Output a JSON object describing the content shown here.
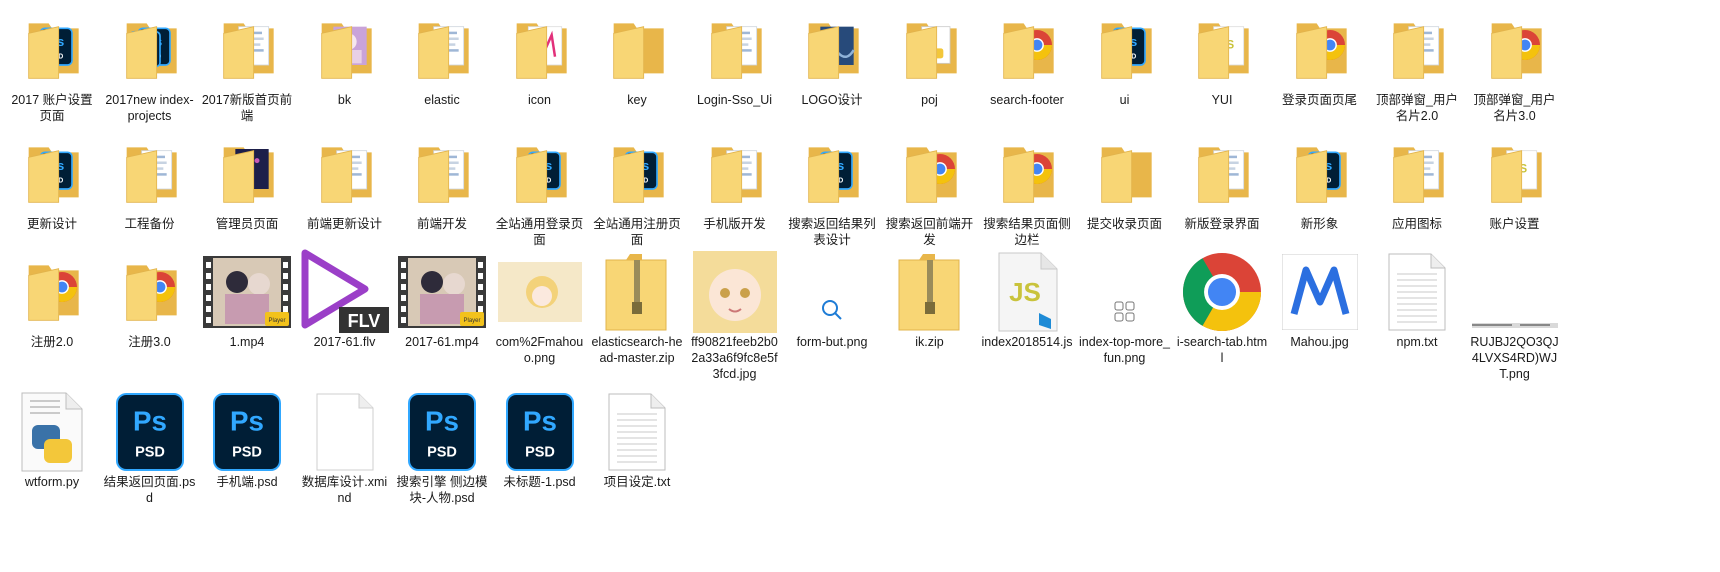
{
  "files": [
    {
      "label": "2017 账户设置页面",
      "icon": "folder",
      "content": "ps"
    },
    {
      "label": "2017new index-projects",
      "icon": "folder",
      "content": "ps2"
    },
    {
      "label": "2017新版首页前端",
      "icon": "folder",
      "content": "docs"
    },
    {
      "label": "bk",
      "icon": "folder",
      "content": "anime"
    },
    {
      "label": "elastic",
      "icon": "folder",
      "content": "docs"
    },
    {
      "label": "icon",
      "icon": "folder",
      "content": "mahou"
    },
    {
      "label": "key",
      "icon": "folder",
      "content": "plain"
    },
    {
      "label": "Login-Sso_Ui",
      "icon": "folder",
      "content": "docs"
    },
    {
      "label": "LOGO设计",
      "icon": "folder",
      "content": "starry"
    },
    {
      "label": "poj",
      "icon": "folder",
      "content": "python"
    },
    {
      "label": "search-footer",
      "icon": "folder",
      "content": "chrome"
    },
    {
      "label": "ui",
      "icon": "folder",
      "content": "ps"
    },
    {
      "label": "YUI",
      "icon": "folder",
      "content": "js"
    },
    {
      "label": "登录页面页尾",
      "icon": "folder",
      "content": "chrome"
    },
    {
      "label": "顶部弹窗_用户名片2.0",
      "icon": "folder",
      "content": "docs"
    },
    {
      "label": "顶部弹窗_用户名片3.0",
      "icon": "folder",
      "content": "chrome"
    },
    {
      "label": "更新设计",
      "icon": "folder",
      "content": "ps"
    },
    {
      "label": "工程备份",
      "icon": "folder",
      "content": "docs"
    },
    {
      "label": "管理员页面",
      "icon": "folder",
      "content": "dark"
    },
    {
      "label": "前端更新设计",
      "icon": "folder",
      "content": "docs"
    },
    {
      "label": "前端开发",
      "icon": "folder",
      "content": "docs"
    },
    {
      "label": "全站通用登录页面",
      "icon": "folder",
      "content": "ps"
    },
    {
      "label": "全站通用注册页面",
      "icon": "folder",
      "content": "ps"
    },
    {
      "label": "手机版开发",
      "icon": "folder",
      "content": "docs"
    },
    {
      "label": "搜索返回结果列表设计",
      "icon": "folder",
      "content": "ps"
    },
    {
      "label": "搜索返回前端开发",
      "icon": "folder",
      "content": "chrome"
    },
    {
      "label": "搜索结果页面侧边栏",
      "icon": "folder",
      "content": "chrome"
    },
    {
      "label": "提交收录页面",
      "icon": "folder",
      "content": "plain"
    },
    {
      "label": "新版登录界面",
      "icon": "folder",
      "content": "docs"
    },
    {
      "label": "新形象",
      "icon": "folder",
      "content": "ps"
    },
    {
      "label": "应用图标",
      "icon": "folder",
      "content": "docs"
    },
    {
      "label": "账户设置",
      "icon": "folder",
      "content": "js"
    },
    {
      "label": "注册2.0",
      "icon": "folder",
      "content": "chrome"
    },
    {
      "label": "注册3.0",
      "icon": "folder",
      "content": "chrome"
    },
    {
      "label": "1.mp4",
      "icon": "video"
    },
    {
      "label": "2017-61.flv",
      "icon": "flv"
    },
    {
      "label": "2017-61.mp4",
      "icon": "video"
    },
    {
      "label": "com%2Fmahouo.png",
      "icon": "anime-thumb"
    },
    {
      "label": "elasticsearch-head-master.zip",
      "icon": "zip"
    },
    {
      "label": "ff90821feeb2b02a33a6f9fc8e5f3fcd.jpg",
      "icon": "anime-face"
    },
    {
      "label": "form-but.png",
      "icon": "small-search"
    },
    {
      "label": "ik.zip",
      "icon": "zip"
    },
    {
      "label": "index2018514.js",
      "icon": "js-file"
    },
    {
      "label": "index-top-more_fun.png",
      "icon": "small-grid"
    },
    {
      "label": "i-search-tab.html",
      "icon": "chrome-big"
    },
    {
      "label": "Mahou.jpg",
      "icon": "mahou-img"
    },
    {
      "label": "npm.txt",
      "icon": "text"
    },
    {
      "label": "RUJBJ2QO3QJ4LVXS4RD)WJT.png",
      "icon": "tiny-text"
    },
    {
      "label": "wtform.py",
      "icon": "py-file"
    },
    {
      "label": "结果返回页面.psd",
      "icon": "psd"
    },
    {
      "label": "手机端.psd",
      "icon": "psd"
    },
    {
      "label": "数据库设计.xmind",
      "icon": "blank"
    },
    {
      "label": "搜索引擎 侧边模块-人物.psd",
      "icon": "psd"
    },
    {
      "label": "未标题-1.psd",
      "icon": "psd"
    },
    {
      "label": "项目设定.txt",
      "icon": "text"
    }
  ],
  "badges": {
    "ps": "Ps",
    "psd": "PSD",
    "flv": "FLV",
    "js": "JS",
    "player": "Player"
  },
  "colors": {
    "folder_back": "#e8b64a",
    "folder_front": "#f8d675",
    "ps_blue": "#31a8ff",
    "ps_bg": "#001e36",
    "flv_purple": "#9b3fc8"
  }
}
